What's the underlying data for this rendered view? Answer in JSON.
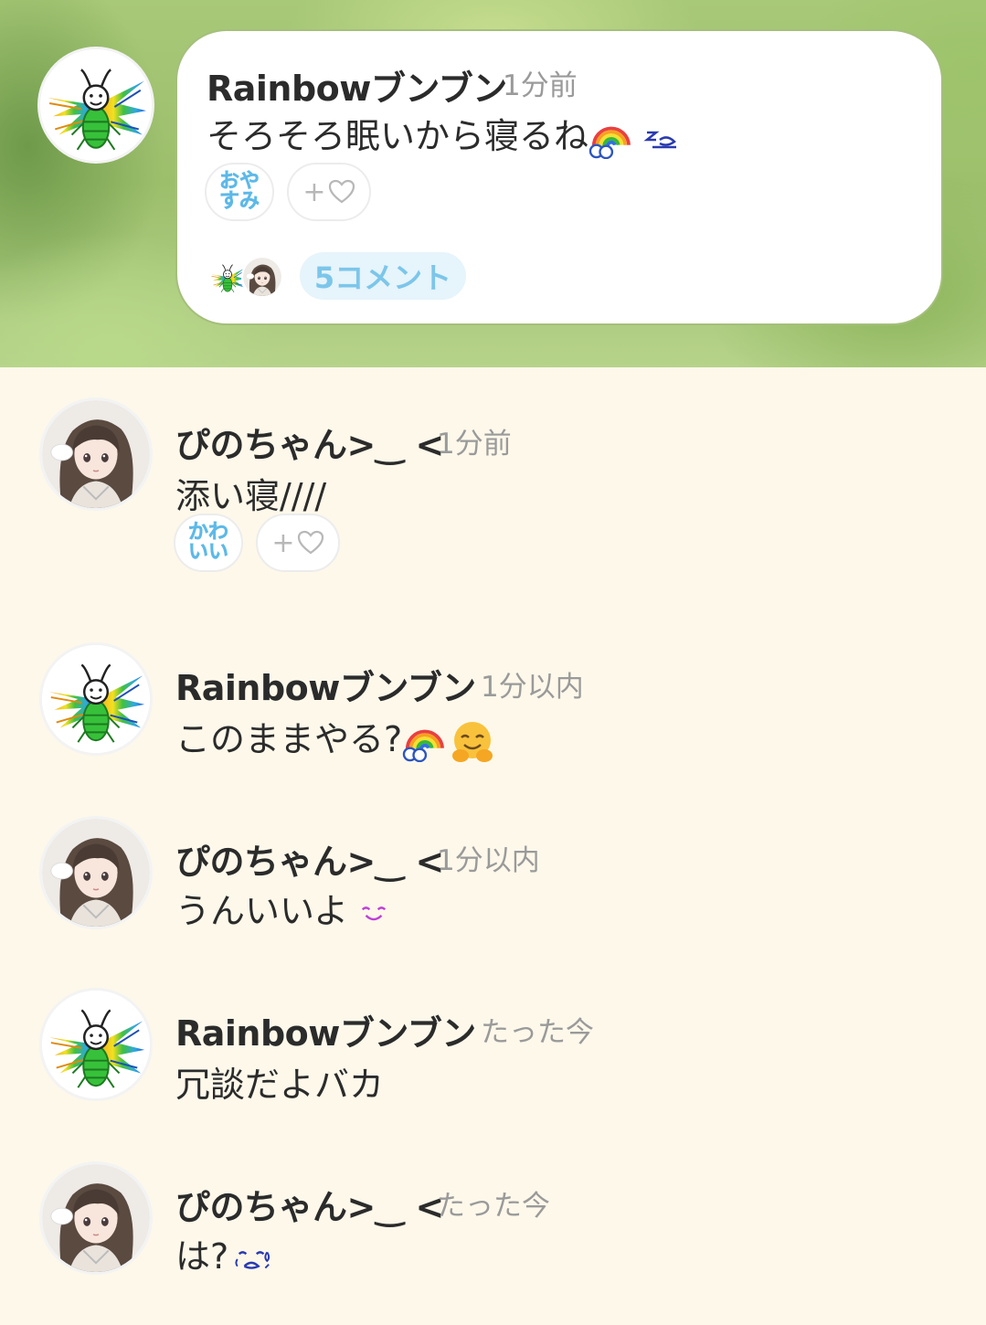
{
  "post": {
    "author": "Rainbowブンブン",
    "time": "1分前",
    "message": "そろそろ眠いから寝るね",
    "stamp": "おやすみ",
    "add_reaction": "+",
    "comments_label": "5コメント"
  },
  "comments": [
    {
      "author": "ぴのちゃん>‿ <",
      "time": "1分前",
      "message": "添い寝////",
      "stamp": "かわいい",
      "add_reaction": "+"
    },
    {
      "author": "Rainbowブンブン",
      "time": "1分以内",
      "message": "このままやる?"
    },
    {
      "author": "ぴのちゃん>‿ <",
      "time": "1分以内",
      "message": "うんいいよ"
    },
    {
      "author": "Rainbowブンブン",
      "time": "たった今",
      "message": "冗談だよバカ"
    },
    {
      "author": "ぴのちゃん>‿ <",
      "time": "たった今",
      "message": "は?"
    }
  ],
  "colors": {
    "accent": "#5db9e8",
    "background": "#fdf8ea",
    "card_border": "#a4bf7b"
  },
  "icons": [
    "bug-avatar",
    "girl-avatar",
    "rainbow-emoji",
    "sleep-emoji",
    "hug-emoji",
    "smile-emoji",
    "sweat-emoji",
    "heart-outline-icon"
  ]
}
